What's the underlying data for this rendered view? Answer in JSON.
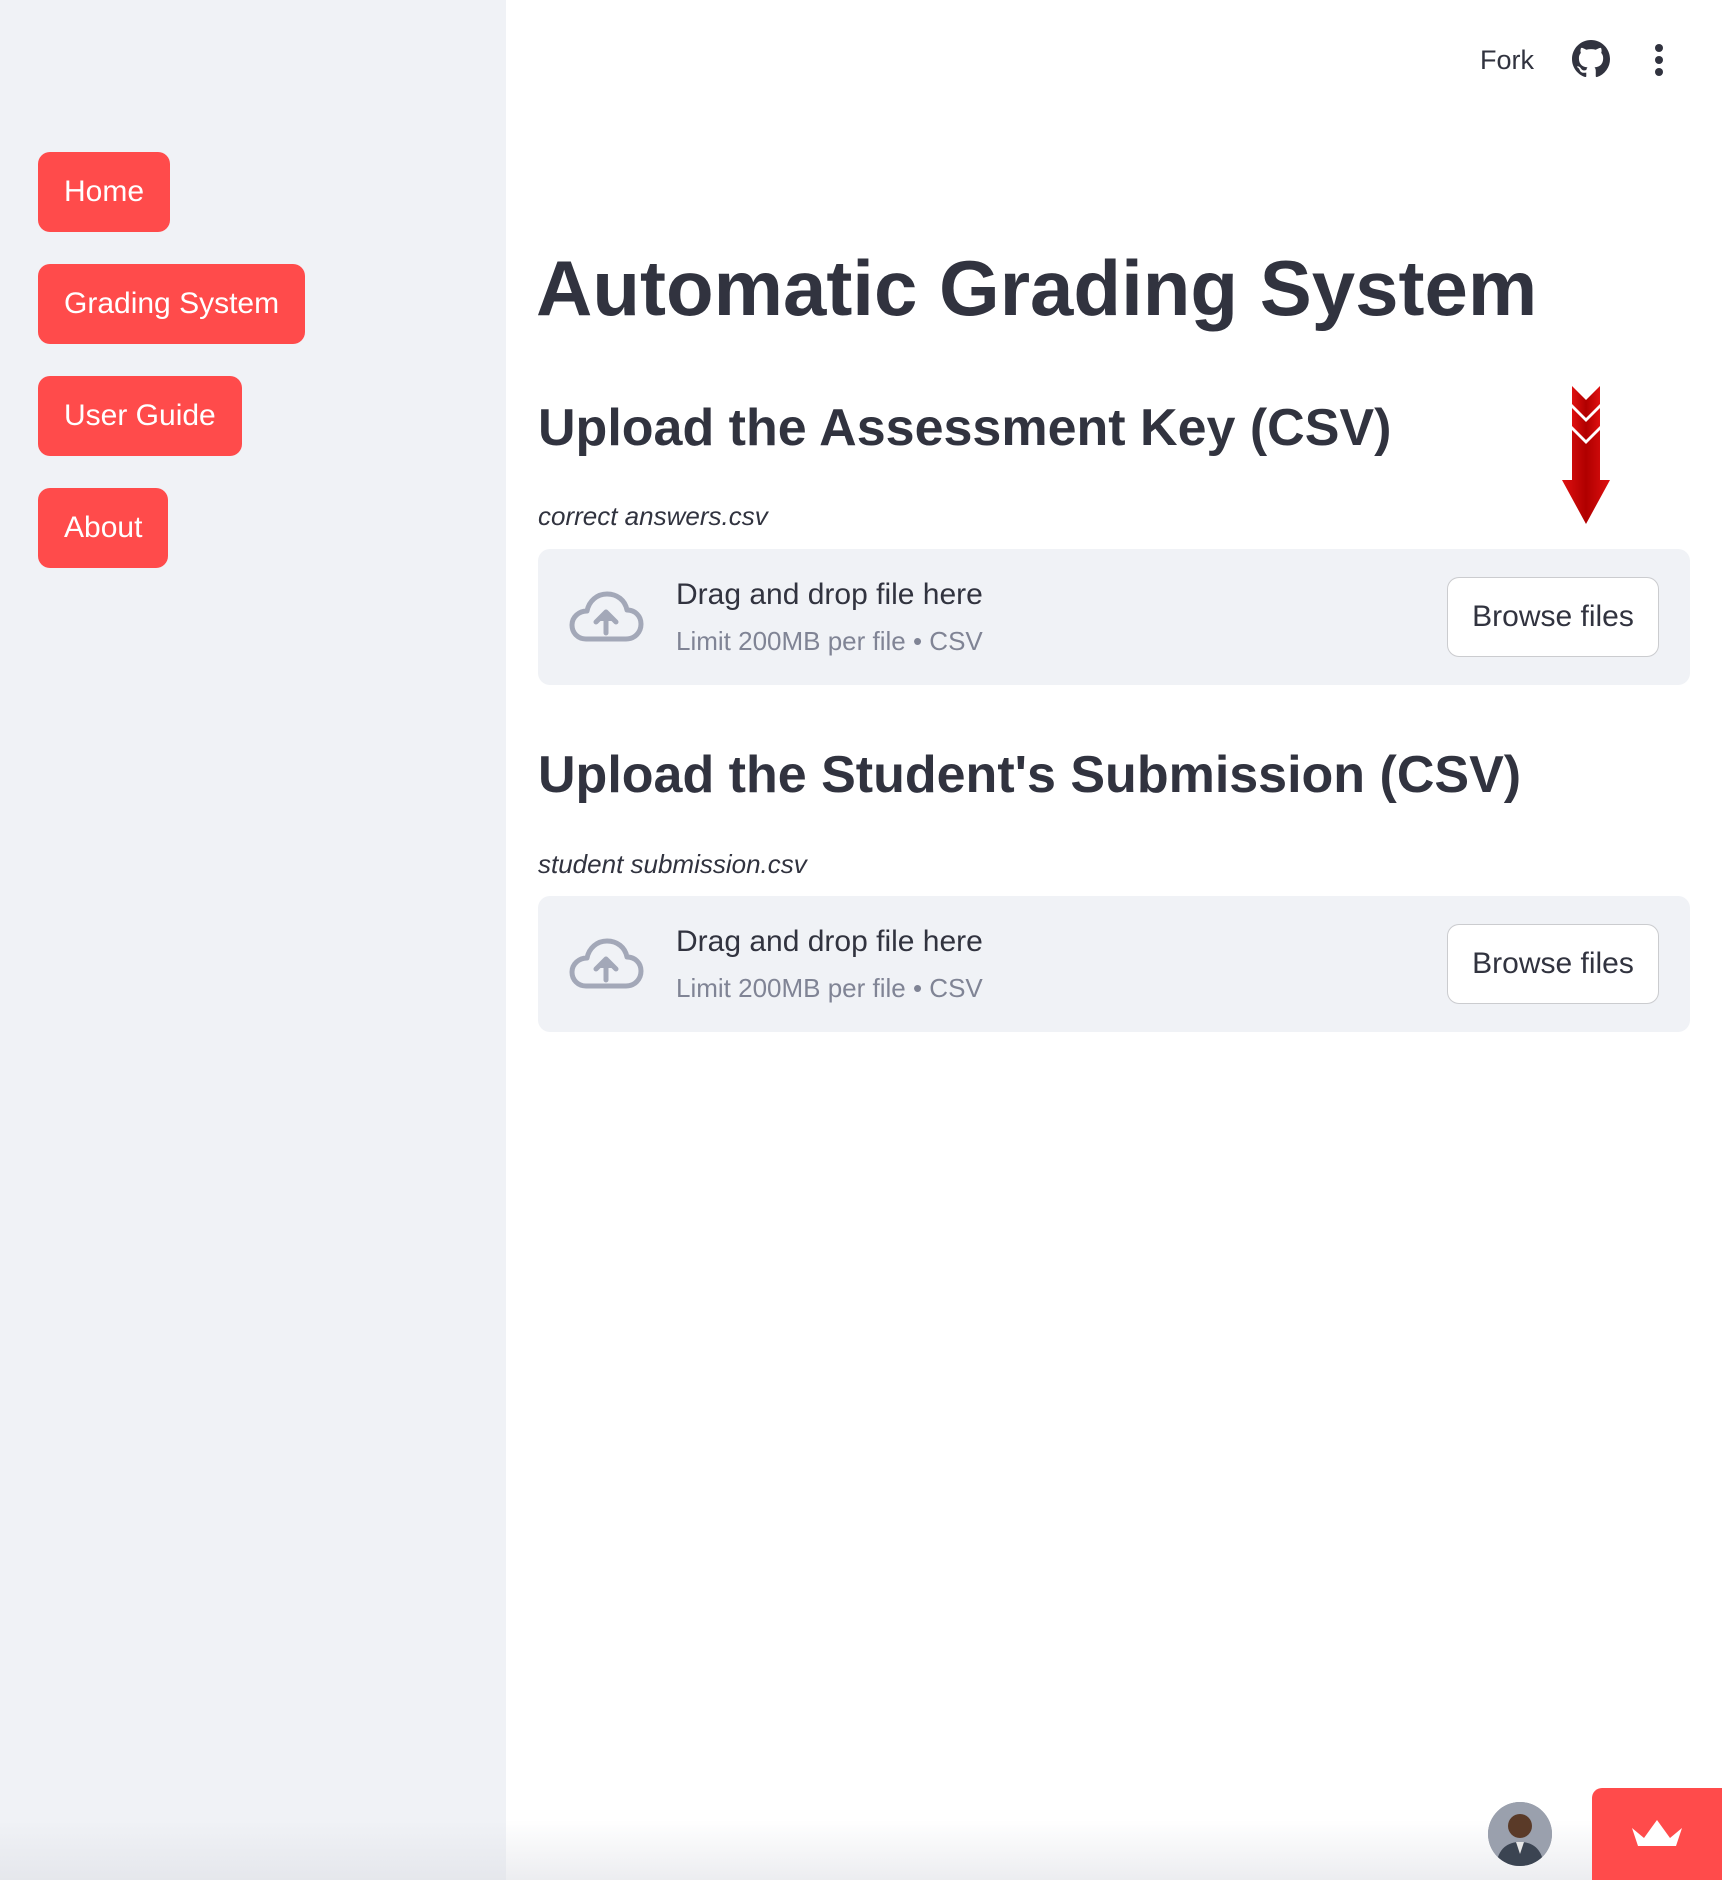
{
  "sidebar": {
    "items": [
      {
        "label": "Home"
      },
      {
        "label": "Grading System"
      },
      {
        "label": "User Guide"
      },
      {
        "label": "About"
      }
    ]
  },
  "header": {
    "fork_label": "Fork",
    "github_icon": "github-icon",
    "menu_icon": "kebab-menu-icon"
  },
  "main": {
    "title": "Automatic Grading System",
    "uploads": [
      {
        "heading": "Upload the Assessment Key (CSV)",
        "caption": "correct answers.csv",
        "drop_text": "Drag and drop file here",
        "limit_text": "Limit 200MB per file • CSV",
        "button_label": "Browse files"
      },
      {
        "heading": "Upload the Student's Submission (CSV)",
        "caption": "student submission.csv",
        "drop_text": "Drag and drop file here",
        "limit_text": "Limit 200MB per file • CSV",
        "button_label": "Browse files"
      }
    ]
  },
  "colors": {
    "accent": "#ff4b4b",
    "sidebar_bg": "#f0f2f6",
    "text": "#31333f",
    "muted_text": "#808495",
    "dropzone_bg": "#f0f2f6",
    "upload_icon": "#a3a8b8",
    "arrow_annotation": "#cc0000"
  }
}
